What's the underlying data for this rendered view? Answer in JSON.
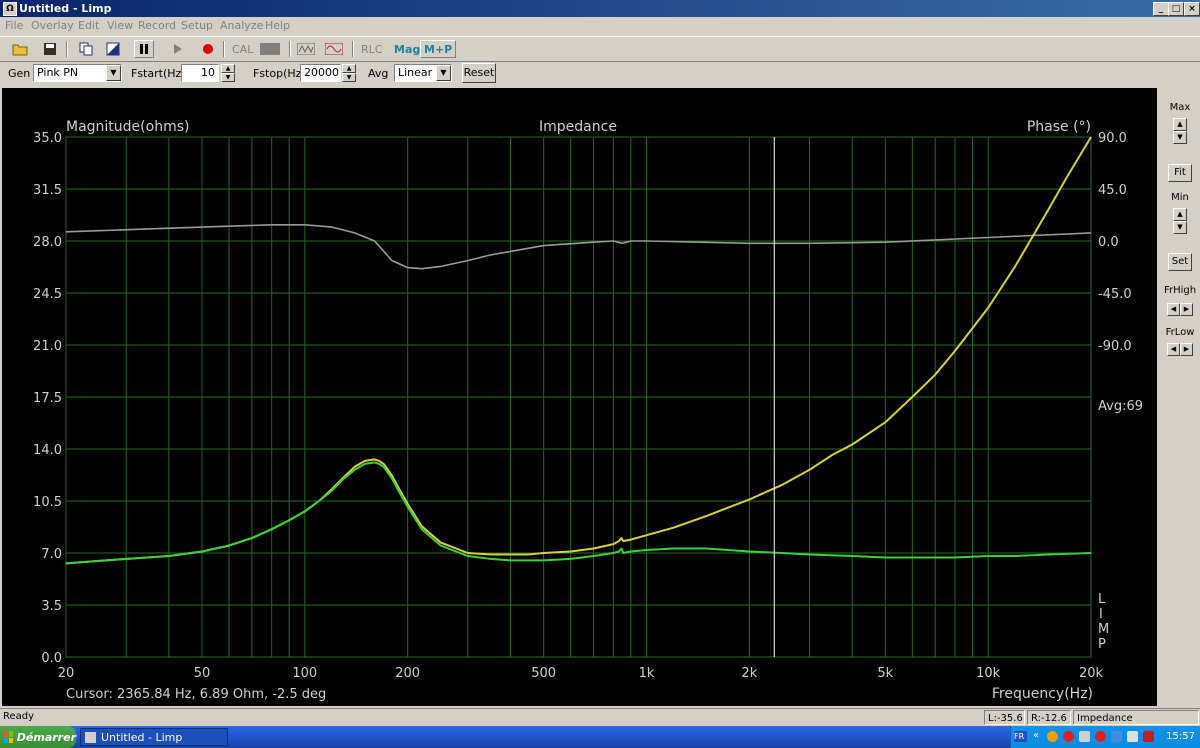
{
  "window": {
    "title": "Untitled - Limp"
  },
  "menu": [
    "File",
    "Overlay",
    "Edit",
    "View",
    "Record",
    "Setup",
    "Analyze",
    "Help"
  ],
  "toolbar": {
    "cal_label": "CAL",
    "rlc_label": "RLC",
    "mag_label": "Mag",
    "mp_label": "M+P"
  },
  "controls": {
    "gen_label": "Gen",
    "gen_value": "Pink PN",
    "fstart_label": "Fstart(Hz)",
    "fstart_value": "10",
    "fstop_label": "Fstop(Hz)",
    "fstop_value": "20000",
    "avg_label": "Avg",
    "avg_value": "Linear",
    "reset_label": "Reset"
  },
  "side_panel": {
    "max": "Max",
    "fit": "Fit",
    "min": "Min",
    "set": "Set",
    "frhigh": "FrHigh",
    "frlow": "FrLow"
  },
  "plot": {
    "cursor_text": "Cursor: 2365.84 Hz, 6.89 Ohm, -2.5 deg",
    "avg_text": "Avg:69",
    "limp_letters": [
      "L",
      "I",
      "M",
      "P"
    ]
  },
  "chart_data": {
    "type": "line",
    "title": "Impedance",
    "xlabel": "Frequency(Hz)",
    "ylabel": "Magnitude(ohms)",
    "y2label": "Phase (°)",
    "xscale": "log",
    "xlim": [
      20,
      20000
    ],
    "ylim": [
      0,
      35
    ],
    "y2lim": [
      -90,
      90
    ],
    "x_ticks": [
      20,
      50,
      100,
      200,
      500,
      1000,
      2000,
      5000,
      10000,
      20000
    ],
    "x_tick_labels": [
      "20",
      "50",
      "100",
      "200",
      "500",
      "1k",
      "2k",
      "5k",
      "10k",
      "20k"
    ],
    "y_ticks": [
      0,
      3.5,
      7,
      10.5,
      14,
      17.5,
      21,
      24.5,
      28,
      31.5,
      35
    ],
    "y_tick_labels": [
      "0.0",
      "3.5",
      "7.0",
      "10.5",
      "14.0",
      "17.5",
      "21.0",
      "24.5",
      "28.0",
      "31.5",
      "35.0"
    ],
    "y2_ticks": [
      90,
      45,
      0,
      -45,
      -90
    ],
    "y2_tick_labels": [
      "90.0",
      "45.0",
      "0.0",
      "-45.0",
      "-90.0"
    ],
    "cursor_x": 2365.84,
    "colors": {
      "background": "#000000",
      "grid": "#1f6e1f",
      "magnitude": "#d8d040",
      "magnitude_overlay": "#3ad03a",
      "phase": "#9a9a9a",
      "cursor": "#ffffff",
      "text": "#d0d0d0"
    },
    "series": [
      {
        "axis": "left",
        "color": "#d8d040",
        "x": [
          20,
          30,
          40,
          50,
          60,
          70,
          80,
          90,
          100,
          110,
          120,
          130,
          140,
          150,
          160,
          165,
          170,
          175,
          180,
          190,
          200,
          220,
          250,
          300,
          350,
          400,
          450,
          500,
          600,
          700,
          800,
          830,
          845,
          855,
          900,
          1000,
          1200,
          1500,
          2000,
          2500,
          3000,
          3500,
          4000,
          5000,
          6000,
          7000,
          8000,
          10000,
          12000,
          15000,
          17000,
          20000
        ],
        "y": [
          6.3,
          6.6,
          6.8,
          7.1,
          7.5,
          8.0,
          8.6,
          9.2,
          9.8,
          10.5,
          11.3,
          12.1,
          12.8,
          13.2,
          13.3,
          13.2,
          13.0,
          12.6,
          12.2,
          11.2,
          10.3,
          8.8,
          7.7,
          7.0,
          6.9,
          6.9,
          6.9,
          7.0,
          7.1,
          7.3,
          7.6,
          7.8,
          8.0,
          7.8,
          7.9,
          8.2,
          8.7,
          9.5,
          10.6,
          11.6,
          12.6,
          13.6,
          14.3,
          15.8,
          17.5,
          19.0,
          20.6,
          23.5,
          26.3,
          30.1,
          32.3,
          35.0
        ]
      },
      {
        "axis": "left",
        "color": "#3ad03a",
        "x": [
          20,
          30,
          40,
          50,
          60,
          70,
          80,
          90,
          100,
          110,
          120,
          130,
          140,
          150,
          160,
          165,
          170,
          175,
          180,
          190,
          200,
          220,
          250,
          300,
          350,
          400,
          450,
          500,
          600,
          700,
          800,
          830,
          845,
          855,
          900,
          1000,
          1200,
          1500,
          2000,
          2500,
          3000,
          4000,
          5000,
          6000,
          7000,
          8000,
          10000,
          12000,
          15000,
          20000
        ],
        "y": [
          6.3,
          6.6,
          6.8,
          7.1,
          7.5,
          8.0,
          8.6,
          9.2,
          9.8,
          10.5,
          11.2,
          12.0,
          12.6,
          13.0,
          13.1,
          13.0,
          12.8,
          12.4,
          12.0,
          11.0,
          10.1,
          8.6,
          7.5,
          6.8,
          6.6,
          6.5,
          6.5,
          6.5,
          6.6,
          6.8,
          7.0,
          7.1,
          7.3,
          7.0,
          7.1,
          7.2,
          7.3,
          7.3,
          7.1,
          7.0,
          6.9,
          6.8,
          6.7,
          6.7,
          6.7,
          6.7,
          6.8,
          6.8,
          6.9,
          7.0
        ]
      },
      {
        "axis": "right",
        "color": "#9a9a9a",
        "x": [
          20,
          50,
          80,
          100,
          120,
          140,
          160,
          180,
          200,
          220,
          250,
          300,
          350,
          400,
          500,
          700,
          800,
          850,
          900,
          1000,
          2000,
          3000,
          5000,
          10000,
          20000
        ],
        "y": [
          8,
          12,
          14,
          14,
          12,
          7,
          0,
          -17,
          -23,
          -24,
          -22,
          -17,
          -12,
          -9,
          -4,
          -1,
          0,
          -2,
          0,
          0,
          -2,
          -2,
          -1,
          3,
          7
        ]
      }
    ]
  }
}
